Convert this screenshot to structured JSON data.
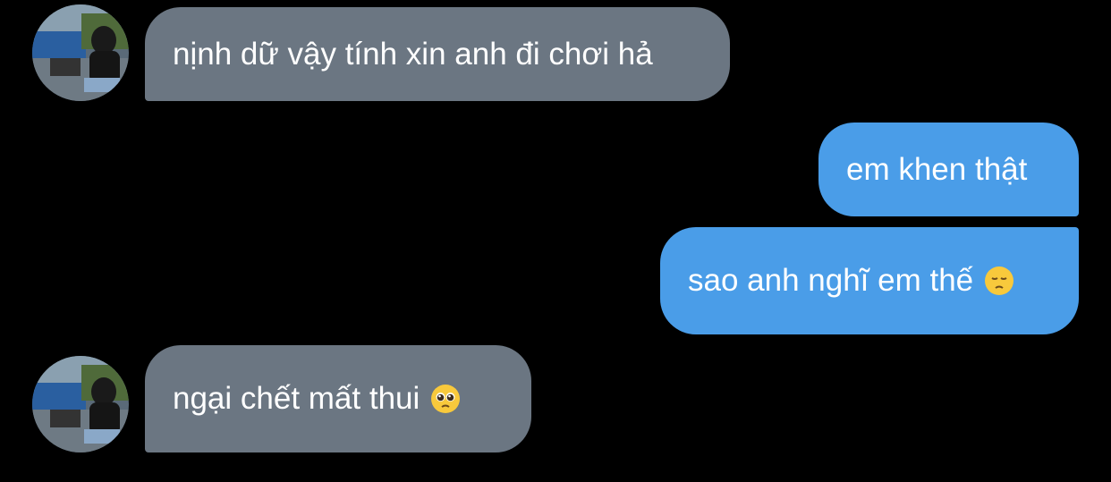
{
  "conversation": {
    "messages": [
      {
        "sender": "them",
        "text": "nịnh dữ vậy tính xin anh đi chơi hả",
        "emoji": null
      },
      {
        "sender": "me",
        "text": "em khen thật",
        "emoji": null
      },
      {
        "sender": "me",
        "text": "sao anh nghĩ em thế",
        "emoji": "pensive-face-emoji"
      },
      {
        "sender": "them",
        "text": "ngại chết mất thui",
        "emoji": "pleading-face-emoji"
      }
    ]
  },
  "colors": {
    "background": "#000000",
    "incoming_bubble": "#6b7682",
    "outgoing_bubble": "#4a9de8",
    "text": "#ffffff"
  }
}
